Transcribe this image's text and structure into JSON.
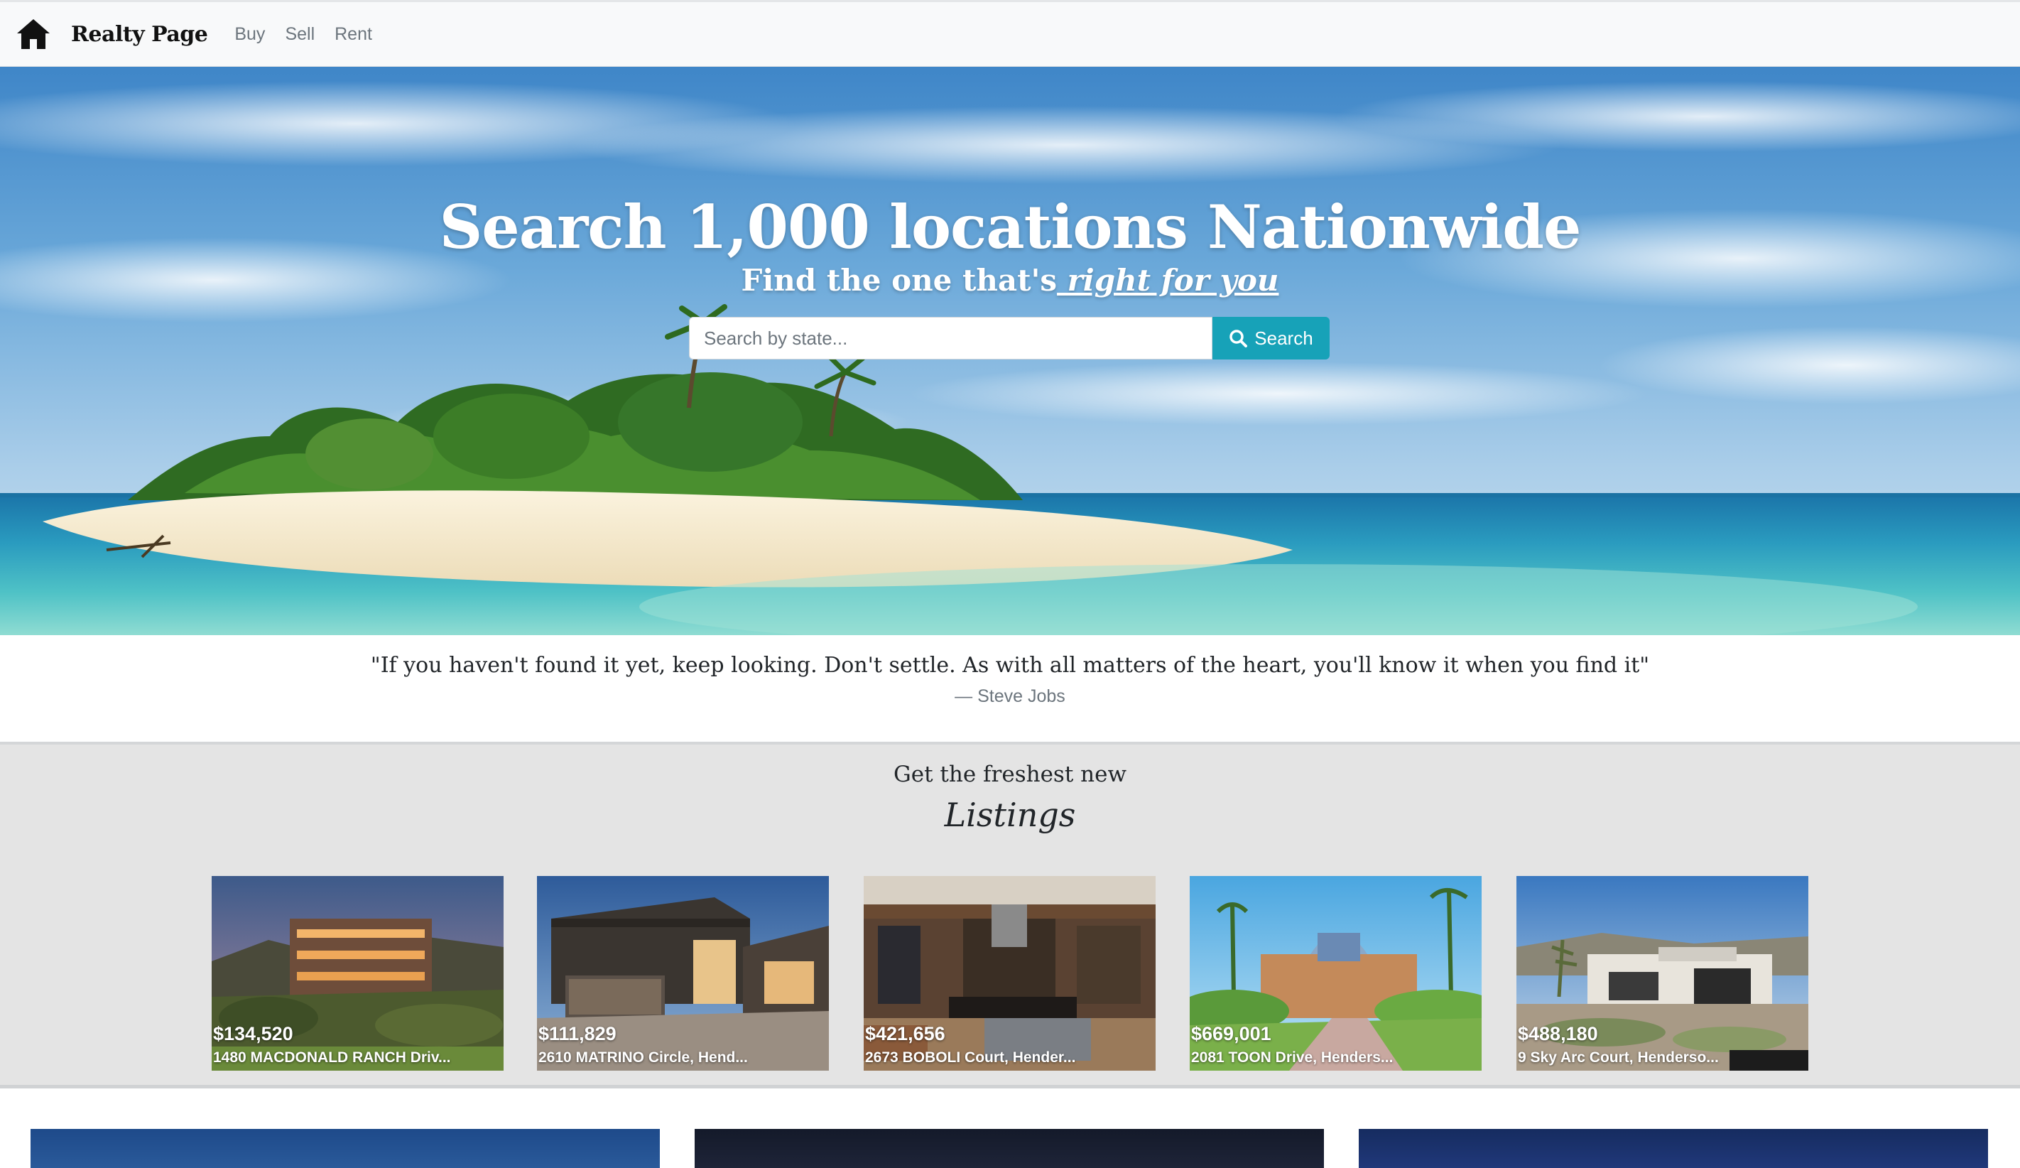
{
  "navbar": {
    "brand": "Realty Page",
    "brand_icon": "house-icon",
    "links": [
      "Buy",
      "Sell",
      "Rent"
    ]
  },
  "hero": {
    "title": "Search 1,000 locations Nationwide",
    "subtitle_prefix": "Find the one that's",
    "subtitle_emphasis": " right for you",
    "search": {
      "placeholder": "Search by state...",
      "value": "",
      "button_label": "Search",
      "button_icon": "search-icon"
    },
    "background": "tropical-island-beach"
  },
  "quote": {
    "text": "\"If you haven't found it yet, keep looking. Don't settle. As with all matters of the heart, you'll know it when you find it\"",
    "author": "— Steve Jobs"
  },
  "listings": {
    "kicker": "Get the freshest new",
    "heading": "Listings",
    "items": [
      {
        "price": "$134,520",
        "address": "1480 MACDONALD RANCH Driv..."
      },
      {
        "price": "$111,829",
        "address": "2610 MATRINO Circle, Hend..."
      },
      {
        "price": "$421,656",
        "address": "2673 BOBOLI Court, Hender..."
      },
      {
        "price": "$669,001",
        "address": "2081 TOON Drive, Henders..."
      },
      {
        "price": "$488,180",
        "address": "9 Sky Arc Court, Henderso..."
      }
    ]
  },
  "colors": {
    "navbar_bg": "#f8f9fa",
    "accent": "#17a2b8",
    "listings_bg": "#e4e4e4",
    "muted_text": "#6c757d"
  }
}
